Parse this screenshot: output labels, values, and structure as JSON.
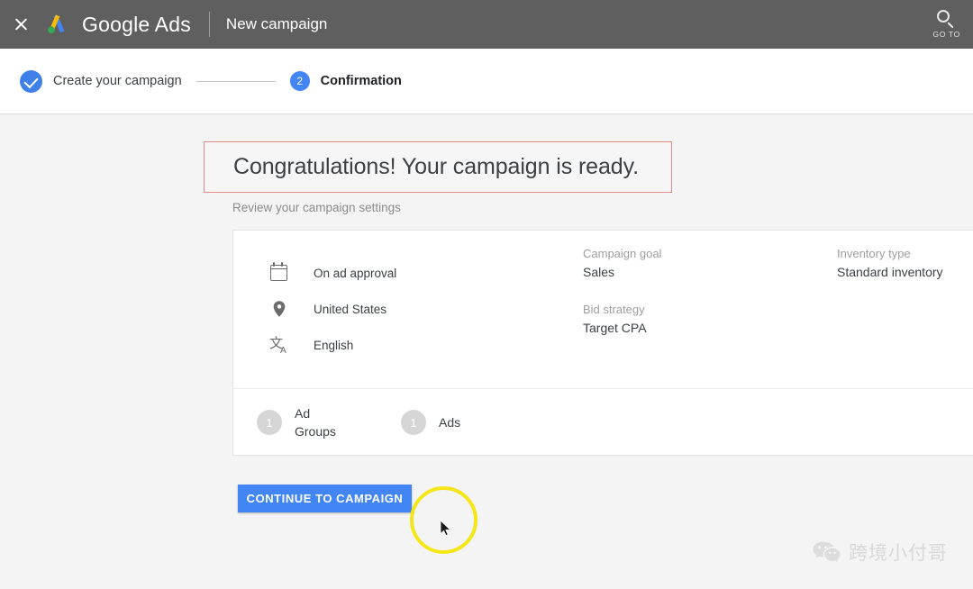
{
  "header": {
    "close_icon": "close-icon",
    "logo_icon": "google-ads-logo",
    "brand": "Google Ads",
    "page_title": "New campaign",
    "search_icon": "search-icon",
    "goto_label": "GO TO"
  },
  "stepper": {
    "steps": [
      {
        "label": "Create your campaign",
        "state": "completed",
        "marker": "check"
      },
      {
        "label": "Confirmation",
        "state": "active",
        "marker": "2"
      }
    ]
  },
  "main": {
    "headline": "Congratulations! Your campaign is ready.",
    "subheadline": "Review your campaign settings",
    "highlight_border_color": "#e08a8a",
    "settings_left": [
      {
        "icon": "calendar-icon",
        "text": "On ad approval"
      },
      {
        "icon": "location-pin-icon",
        "text": "United States"
      },
      {
        "icon": "translate-icon",
        "text": "English"
      }
    ],
    "settings_mid": [
      {
        "label": "Campaign goal",
        "value": "Sales"
      },
      {
        "label": "Bid strategy",
        "value": "Target CPA"
      }
    ],
    "settings_right": [
      {
        "label": "Inventory type",
        "value": "Standard inventory"
      }
    ],
    "counts": [
      {
        "count": "1",
        "label": "Ad Groups"
      },
      {
        "count": "1",
        "label": "Ads"
      }
    ],
    "cta_label": "CONTINUE TO CAMPAIGN",
    "cta_color": "#4285f4"
  },
  "overlay": {
    "cursor_ring_color": "#f5e61a",
    "cursor_icon": "mouse-pointer-icon"
  },
  "watermark": {
    "icon": "wechat-icon",
    "text": "跨境小付哥"
  }
}
